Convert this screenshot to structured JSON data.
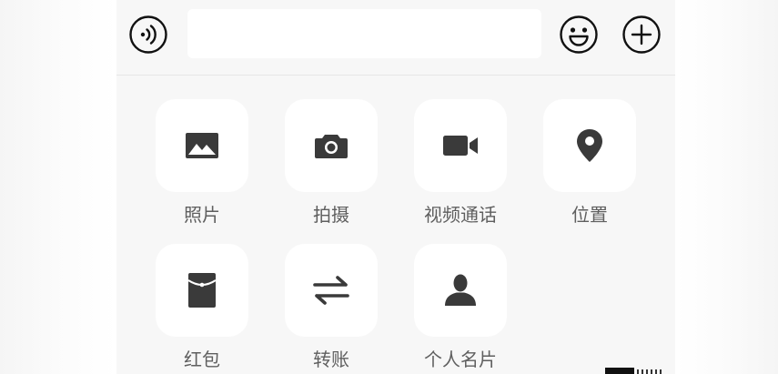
{
  "input_bar": {
    "voice_icon": "voice-icon",
    "emoji_icon": "smiley-icon",
    "plus_icon": "plus-icon",
    "text_value": "",
    "placeholder": ""
  },
  "panel": {
    "items": [
      {
        "label": "照片",
        "icon": "image-icon"
      },
      {
        "label": "拍摄",
        "icon": "camera-icon"
      },
      {
        "label": "视频通话",
        "icon": "video-camera-icon"
      },
      {
        "label": "位置",
        "icon": "location-pin-icon"
      },
      {
        "label": "红包",
        "icon": "red-envelope-icon"
      },
      {
        "label": "转账",
        "icon": "transfer-arrows-icon"
      },
      {
        "label": "个人名片",
        "icon": "contact-card-icon"
      }
    ]
  },
  "colors": {
    "panel_background": "#f7f7f7",
    "tile_background": "#ffffff",
    "icon": "#3a3a3a",
    "label": "#5f5f5f"
  }
}
